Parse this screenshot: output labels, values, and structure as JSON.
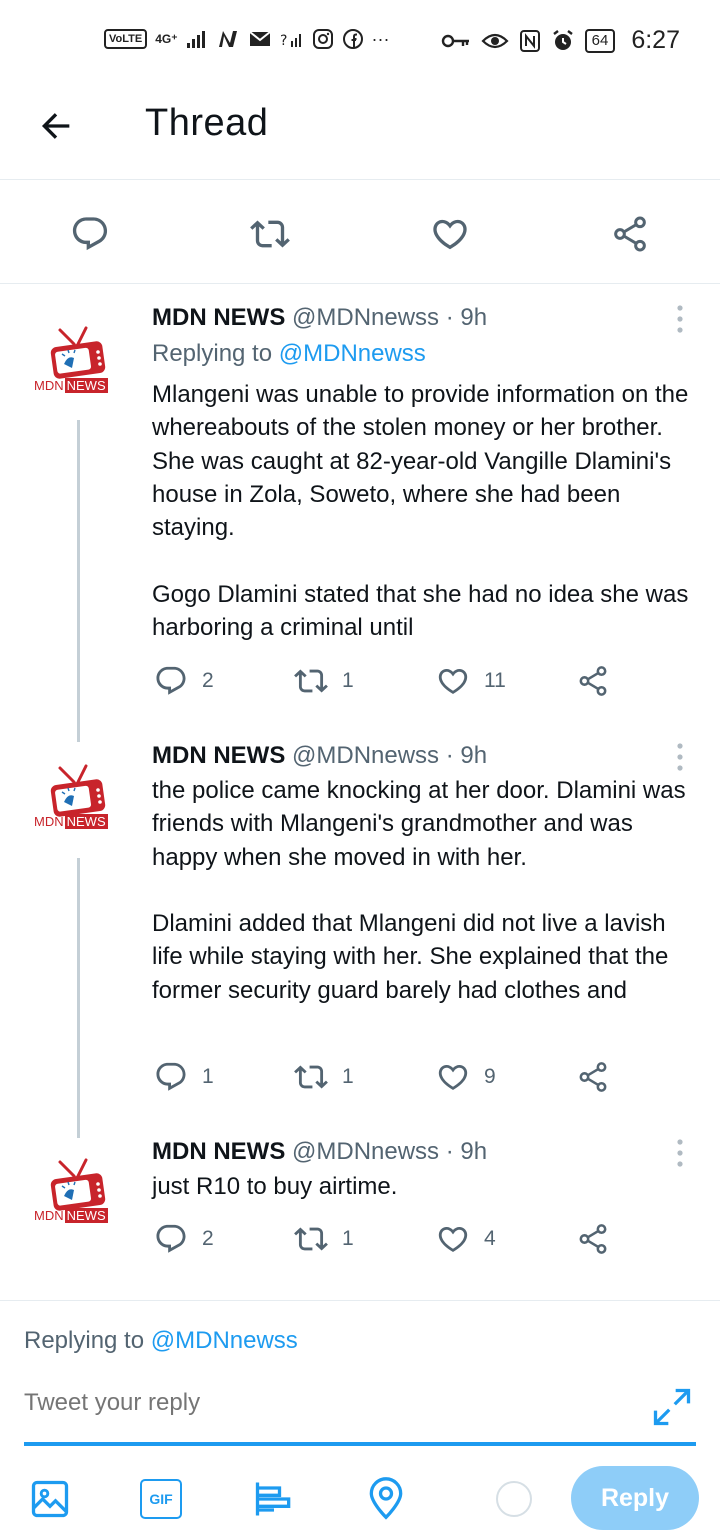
{
  "status_bar": {
    "volte": "VoLTE",
    "network": "4G⁺",
    "battery": "64",
    "time": "6:27"
  },
  "header": {
    "title": "Thread"
  },
  "tweets": [
    {
      "name": "MDN NEWS",
      "handle": "@MDNnewss · 9h",
      "replying_label": "Replying to ",
      "replying_handle": "@MDNnewss",
      "text": "Mlangeni was unable to provide information on the whereabouts of the stolen money or her brother. She was caught at 82-year-old Vangille Dlamini's house in Zola, Soweto, where she had been staying.\n\nGogo Dlamini stated that she had no idea she was harboring a criminal until",
      "replies": "2",
      "retweets": "1",
      "likes": "11"
    },
    {
      "name": "MDN NEWS",
      "handle": "@MDNnewss · 9h",
      "text": "the police came knocking at her door. Dlamini was friends with Mlangeni's grandmother and was happy when she moved in with her.\n\nDlamini added that Mlangeni did not live a lavish life while staying with her. She explained that the former security guard barely had clothes and",
      "replies": "1",
      "retweets": "1",
      "likes": "9"
    },
    {
      "name": "MDN NEWS",
      "handle": "@MDNnewss · 9h",
      "text": "just R10 to buy airtime.",
      "replies": "2",
      "retweets": "1",
      "likes": "4"
    }
  ],
  "avatar_logo": {
    "text_left": "MDN",
    "text_right": "NEWS"
  },
  "composer": {
    "replying_label": "Replying to ",
    "replying_handle": "@MDNnewss",
    "placeholder": "Tweet your reply",
    "gif_label": "GIF",
    "reply_button": "Reply"
  },
  "colors": {
    "accent": "#1d9bf0",
    "reply_button_disabled": "#8ecdf8",
    "text_secondary": "#536471",
    "logo_red": "#c8242b",
    "logo_blue": "#1f6fb5"
  },
  "icons": {
    "back": "arrow-left-icon",
    "reply": "speech-bubble-icon",
    "retweet": "retweet-icon",
    "like": "heart-icon",
    "share": "share-icon",
    "more": "more-vertical-icon",
    "image": "image-icon",
    "gif": "gif-icon",
    "poll": "poll-icon",
    "location": "location-pin-icon",
    "expand": "expand-icon"
  }
}
